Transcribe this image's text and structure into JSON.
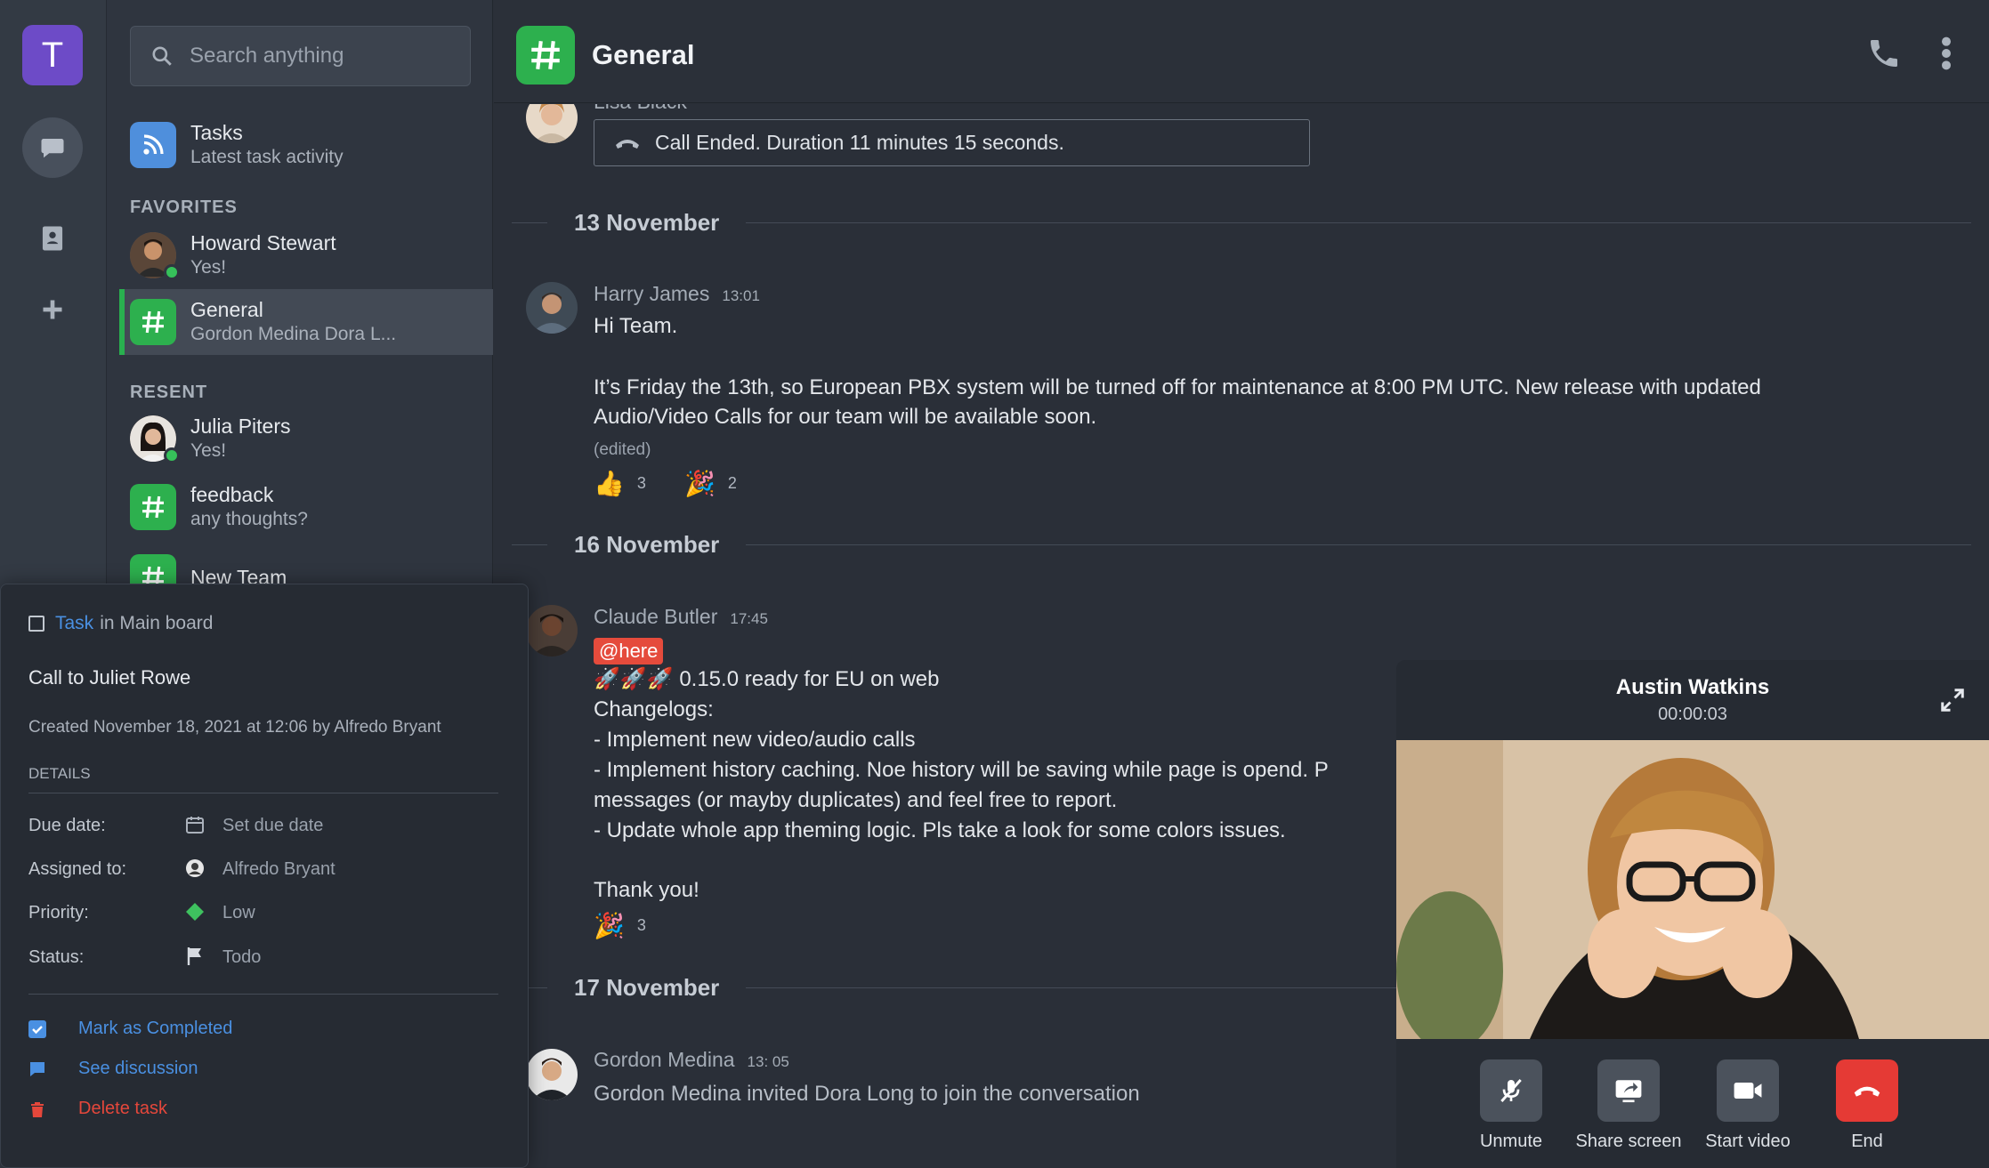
{
  "workspace": {
    "initial": "T"
  },
  "search": {
    "placeholder": "Search anything"
  },
  "sidebar": {
    "tasks": {
      "title": "Tasks",
      "subtitle": "Latest task activity"
    },
    "favorites_label": "FAVORITES",
    "favorites": [
      {
        "title": "Howard Stewart",
        "subtitle": "Yes!"
      },
      {
        "title": "General",
        "subtitle": "Gordon Medina Dora L..."
      }
    ],
    "recent_label": "RESENT",
    "recent": [
      {
        "title": "Julia Piters",
        "subtitle": "Yes!"
      },
      {
        "title": "feedback",
        "subtitle": "any thoughts?"
      },
      {
        "title": "New Team",
        "subtitle": ""
      }
    ]
  },
  "header": {
    "title": "General"
  },
  "feed": {
    "top_partial_name": "Lisa Black",
    "call_ended": "Call Ended. Duration 11 minutes 15 seconds.",
    "days": [
      "13 November",
      "16  November",
      "17  November"
    ],
    "msg1": {
      "name": "Harry James",
      "time": "13:01",
      "line1": "Hi Team.",
      "line2": "It’s Friday the 13th, so European PBX system will be turned off for maintenance at 8:00 PM UTC. New release with updated",
      "line3": "Audio/Video Calls for our team will be available soon.",
      "edited": "(edited)",
      "reactions": [
        {
          "emoji": "👍",
          "count": "3"
        },
        {
          "emoji": "🎉",
          "count": "2"
        }
      ]
    },
    "msg2": {
      "name": "Claude Butler",
      "time": "17:45",
      "mention": "@here",
      "lines": [
        "🚀🚀🚀 0.15.0 ready for EU on web",
        "Changelogs:",
        "- Implement new video/audio calls",
        "- Implement history caching. Noe history will be saving while page is opend. P",
        "messages (or mayby duplicates) and  feel free to report.",
        "- Update whole app theming logic. Pls take a look for some colors issues."
      ],
      "thanks": "Thank you!",
      "reactions": [
        {
          "emoji": "🎉",
          "count": "3"
        }
      ]
    },
    "msg3": {
      "name": "Gordon Medina",
      "time": "13: 05",
      "text": "Gordon Medina invited Dora Long to join the conversation"
    }
  },
  "task": {
    "link": "Task",
    "board": "in Main board",
    "title": "Call to Juliet Rowe",
    "created": "Created November 18, 2021 at 12:06 by Alfredo Bryant",
    "details_label": "DETAILS",
    "fields": [
      {
        "label": "Due date:",
        "value": "Set due date"
      },
      {
        "label": "Assigned to:",
        "value": "Alfredo Bryant"
      },
      {
        "label": "Priority:",
        "value": "Low"
      },
      {
        "label": "Status:",
        "value": "Todo"
      }
    ],
    "actions": {
      "complete": "Mark as Completed",
      "discussion": "See discussion",
      "delete": "Delete task"
    }
  },
  "call": {
    "name": "Austin Watkins",
    "duration": "00:00:03",
    "buttons": {
      "unmute": "Unmute",
      "share": "Share screen",
      "video": "Start video",
      "end": "End"
    }
  },
  "colors": {
    "accent_green": "#2db04e",
    "link_blue": "#4a90e2",
    "danger": "#e53a35",
    "workspace": "#6d4bc7"
  }
}
